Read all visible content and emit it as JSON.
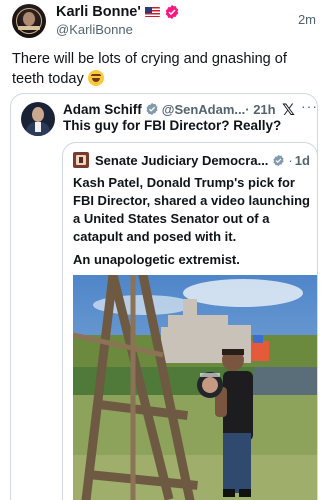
{
  "post": {
    "display_name": "Karli Bonne'",
    "handle": "@KarliBonne",
    "time": "2m",
    "text": "There will be lots of crying and gnashing of teeth today"
  },
  "quote": {
    "display_name": "Adam Schiff",
    "handle": "@SenAdam...",
    "time": "· 21h",
    "text": "This guy for FBI Director? Really?"
  },
  "inner_quote": {
    "display_name": "Senate Judiciary Democra...",
    "time": "1d",
    "separator": "·",
    "text": "Kash Patel, Donald Trump's pick for FBI Director, shared a video launching a United States Senator out of a catapult and posed with it.",
    "text2": "An unapologetic extremist."
  },
  "colors": {
    "verified_badge": "#f91880",
    "verified_badge_blue": "#1d9bf0",
    "text_primary": "#0f1419",
    "text_secondary": "#536471",
    "border": "#cfd9de"
  },
  "icons": [
    "verified-badge-icon",
    "us-flag-icon",
    "laughing-emoji-icon",
    "x-logo-icon",
    "more-icon",
    "senate-logo-icon"
  ]
}
